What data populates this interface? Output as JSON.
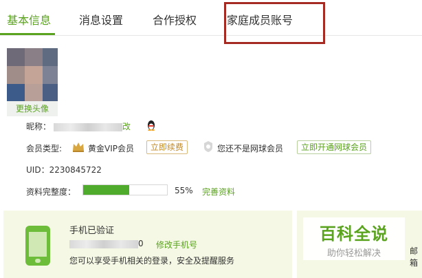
{
  "tabs": [
    {
      "label": "基本信息",
      "active": true
    },
    {
      "label": "消息设置",
      "active": false
    },
    {
      "label": "合作授权",
      "active": false
    },
    {
      "label": "家庭成员账号",
      "active": false
    }
  ],
  "avatar": {
    "change_label": "更换头像"
  },
  "profile": {
    "nickname_label": "昵称：",
    "nickname_edit_tail": "改",
    "member_type_label": "会员类型:",
    "member_level": "黄金VIP会员",
    "renew_button": "立即续费",
    "net_member_status": "您还不是网球会员",
    "open_net_button": "立即开通网球会员",
    "uid_text": "UID：2230845722",
    "completeness_label": "资料完整度：",
    "completeness_percent": "55%",
    "completeness_value": 0.55,
    "complete_link": "完善资料"
  },
  "phone": {
    "title": "手机已验证",
    "number_tail": "0",
    "modify_link": "修改手机号",
    "description": "您可以享受手机相关的登录，安全及提醒服务"
  },
  "watermark": {
    "title": "百科全说",
    "subtitle": "助你轻松解决"
  },
  "right_edge_text": "邮箱",
  "colors": {
    "accent": "#5aa31e",
    "highlight": "#a52a22",
    "panel": "#f4f8e4",
    "progress": "#4fab2c"
  },
  "icons": [
    "qq-penguin-icon",
    "crown-icon",
    "net-badge-icon",
    "phone-icon"
  ]
}
